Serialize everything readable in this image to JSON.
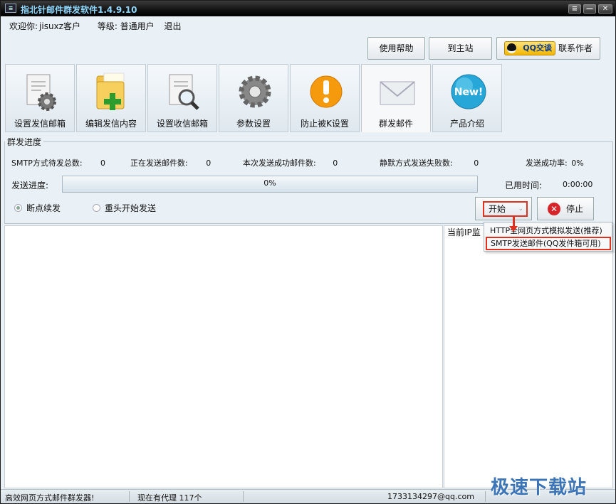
{
  "window": {
    "title": "指北针邮件群发软件1.4.9.10",
    "controls": [
      "≡",
      "—",
      "□",
      "✕"
    ]
  },
  "user": {
    "welcome": "欢迎你:",
    "username": "jisuxz客户",
    "level": "等级: 普通用户",
    "logout": "退出"
  },
  "top_buttons": {
    "help": "使用帮助",
    "home": "到主站",
    "qq_logo_text": "QQ交谈",
    "contact": "联系作者"
  },
  "tabs": [
    {
      "label": "设置发信邮箱",
      "icon": "document-gear-icon"
    },
    {
      "label": "编辑发信内容",
      "icon": "folder-add-icon"
    },
    {
      "label": "设置收信邮箱",
      "icon": "document-search-icon"
    },
    {
      "label": "参数设置",
      "icon": "gear-icon"
    },
    {
      "label": "防止被K设置",
      "icon": "warning-icon"
    },
    {
      "label": "群发邮件",
      "icon": "envelope-icon",
      "active": true
    },
    {
      "label": "产品介绍",
      "icon": "new-badge-icon"
    }
  ],
  "progress_group": {
    "title": "群发进度",
    "stats": [
      {
        "label": "SMTP方式待发总数:",
        "value": "0"
      },
      {
        "label": "正在发送邮件数:",
        "value": "0"
      },
      {
        "label": "本次发送成功邮件数:",
        "value": "0"
      },
      {
        "label": "静默方式发送失败数:",
        "value": "0"
      },
      {
        "label": "发送成功率:",
        "value": "0%"
      }
    ],
    "progress_label": "发送进度:",
    "progress_text": "0%",
    "progress_value": 0,
    "elapsed_label": "已用时间:",
    "elapsed_value": "0:00:00",
    "radio_resume": "断点续发",
    "radio_restart": "重头开始发送",
    "start_label": "开始",
    "stop_label": "停止"
  },
  "right_panel": {
    "label": "当前IP监"
  },
  "dropdown": {
    "items": [
      "HTTP全网页方式模拟发送(推荐)",
      "SMTP发送邮件(QQ发件箱可用)"
    ]
  },
  "status": {
    "left": "高效网页方式邮件群发器!",
    "proxy": "现在有代理 117个",
    "email": "1733134297@qq.com"
  },
  "watermark": "极速下载站",
  "colors": {
    "highlight_red": "#e0301e",
    "title_text": "#8fd7ff"
  }
}
